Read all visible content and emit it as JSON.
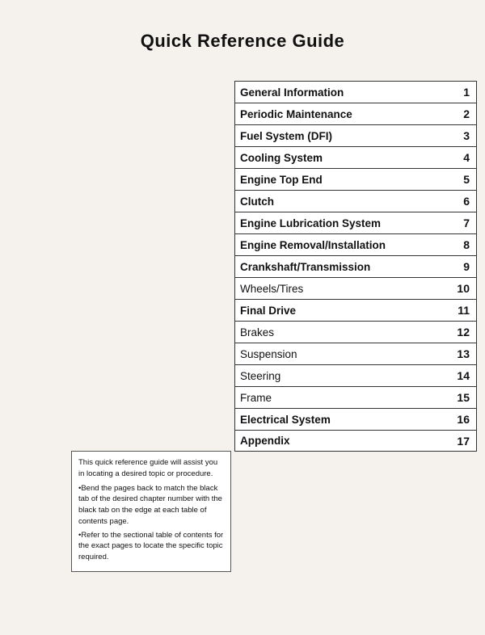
{
  "page": {
    "title": "Quick Reference Guide"
  },
  "toc": {
    "items": [
      {
        "label": "General Information",
        "num": "1",
        "bold": true
      },
      {
        "label": "Periodic Maintenance",
        "num": "2",
        "bold": true
      },
      {
        "label": "Fuel System (DFI)",
        "num": "3",
        "bold": true
      },
      {
        "label": "Cooling System",
        "num": "4",
        "bold": true
      },
      {
        "label": "Engine Top End",
        "num": "5",
        "bold": true
      },
      {
        "label": "Clutch",
        "num": "6",
        "bold": true
      },
      {
        "label": "Engine Lubrication System",
        "num": "7",
        "bold": true
      },
      {
        "label": "Engine Removal/Installation",
        "num": "8",
        "bold": true
      },
      {
        "label": "Crankshaft/Transmission",
        "num": "9",
        "bold": true
      },
      {
        "label": "Wheels/Tires",
        "num": "10",
        "bold": false
      },
      {
        "label": "Final Drive",
        "num": "11",
        "bold": true
      },
      {
        "label": "Brakes",
        "num": "12",
        "bold": false
      },
      {
        "label": "Suspension",
        "num": "13",
        "bold": false
      },
      {
        "label": "Steering",
        "num": "14",
        "bold": false
      },
      {
        "label": "Frame",
        "num": "15",
        "bold": false
      },
      {
        "label": "Electrical System",
        "num": "16",
        "bold": true
      },
      {
        "label": "Appendix",
        "num": "17",
        "bold": true
      }
    ]
  },
  "info_box": {
    "lines": [
      "This quick reference guide will assist you in locating a desired topic or procedure.",
      "•Bend the pages back to match the black tab of the desired chapter number with the black tab on the edge at each table of contents page.",
      "•Refer to the sectional table of contents for the exact pages to locate the specific topic required."
    ]
  }
}
